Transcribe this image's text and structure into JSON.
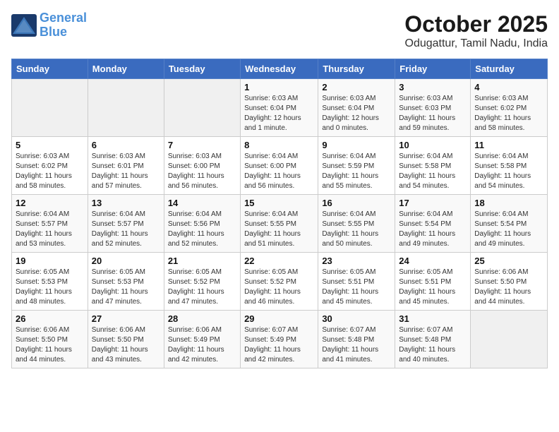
{
  "header": {
    "logo_line1": "General",
    "logo_line2": "Blue",
    "month": "October 2025",
    "location": "Odugattur, Tamil Nadu, India"
  },
  "weekdays": [
    "Sunday",
    "Monday",
    "Tuesday",
    "Wednesday",
    "Thursday",
    "Friday",
    "Saturday"
  ],
  "weeks": [
    [
      {
        "day": "",
        "info": ""
      },
      {
        "day": "",
        "info": ""
      },
      {
        "day": "",
        "info": ""
      },
      {
        "day": "1",
        "info": "Sunrise: 6:03 AM\nSunset: 6:04 PM\nDaylight: 12 hours\nand 1 minute."
      },
      {
        "day": "2",
        "info": "Sunrise: 6:03 AM\nSunset: 6:04 PM\nDaylight: 12 hours\nand 0 minutes."
      },
      {
        "day": "3",
        "info": "Sunrise: 6:03 AM\nSunset: 6:03 PM\nDaylight: 11 hours\nand 59 minutes."
      },
      {
        "day": "4",
        "info": "Sunrise: 6:03 AM\nSunset: 6:02 PM\nDaylight: 11 hours\nand 58 minutes."
      }
    ],
    [
      {
        "day": "5",
        "info": "Sunrise: 6:03 AM\nSunset: 6:02 PM\nDaylight: 11 hours\nand 58 minutes."
      },
      {
        "day": "6",
        "info": "Sunrise: 6:03 AM\nSunset: 6:01 PM\nDaylight: 11 hours\nand 57 minutes."
      },
      {
        "day": "7",
        "info": "Sunrise: 6:03 AM\nSunset: 6:00 PM\nDaylight: 11 hours\nand 56 minutes."
      },
      {
        "day": "8",
        "info": "Sunrise: 6:04 AM\nSunset: 6:00 PM\nDaylight: 11 hours\nand 56 minutes."
      },
      {
        "day": "9",
        "info": "Sunrise: 6:04 AM\nSunset: 5:59 PM\nDaylight: 11 hours\nand 55 minutes."
      },
      {
        "day": "10",
        "info": "Sunrise: 6:04 AM\nSunset: 5:58 PM\nDaylight: 11 hours\nand 54 minutes."
      },
      {
        "day": "11",
        "info": "Sunrise: 6:04 AM\nSunset: 5:58 PM\nDaylight: 11 hours\nand 54 minutes."
      }
    ],
    [
      {
        "day": "12",
        "info": "Sunrise: 6:04 AM\nSunset: 5:57 PM\nDaylight: 11 hours\nand 53 minutes."
      },
      {
        "day": "13",
        "info": "Sunrise: 6:04 AM\nSunset: 5:57 PM\nDaylight: 11 hours\nand 52 minutes."
      },
      {
        "day": "14",
        "info": "Sunrise: 6:04 AM\nSunset: 5:56 PM\nDaylight: 11 hours\nand 52 minutes."
      },
      {
        "day": "15",
        "info": "Sunrise: 6:04 AM\nSunset: 5:55 PM\nDaylight: 11 hours\nand 51 minutes."
      },
      {
        "day": "16",
        "info": "Sunrise: 6:04 AM\nSunset: 5:55 PM\nDaylight: 11 hours\nand 50 minutes."
      },
      {
        "day": "17",
        "info": "Sunrise: 6:04 AM\nSunset: 5:54 PM\nDaylight: 11 hours\nand 49 minutes."
      },
      {
        "day": "18",
        "info": "Sunrise: 6:04 AM\nSunset: 5:54 PM\nDaylight: 11 hours\nand 49 minutes."
      }
    ],
    [
      {
        "day": "19",
        "info": "Sunrise: 6:05 AM\nSunset: 5:53 PM\nDaylight: 11 hours\nand 48 minutes."
      },
      {
        "day": "20",
        "info": "Sunrise: 6:05 AM\nSunset: 5:53 PM\nDaylight: 11 hours\nand 47 minutes."
      },
      {
        "day": "21",
        "info": "Sunrise: 6:05 AM\nSunset: 5:52 PM\nDaylight: 11 hours\nand 47 minutes."
      },
      {
        "day": "22",
        "info": "Sunrise: 6:05 AM\nSunset: 5:52 PM\nDaylight: 11 hours\nand 46 minutes."
      },
      {
        "day": "23",
        "info": "Sunrise: 6:05 AM\nSunset: 5:51 PM\nDaylight: 11 hours\nand 45 minutes."
      },
      {
        "day": "24",
        "info": "Sunrise: 6:05 AM\nSunset: 5:51 PM\nDaylight: 11 hours\nand 45 minutes."
      },
      {
        "day": "25",
        "info": "Sunrise: 6:06 AM\nSunset: 5:50 PM\nDaylight: 11 hours\nand 44 minutes."
      }
    ],
    [
      {
        "day": "26",
        "info": "Sunrise: 6:06 AM\nSunset: 5:50 PM\nDaylight: 11 hours\nand 44 minutes."
      },
      {
        "day": "27",
        "info": "Sunrise: 6:06 AM\nSunset: 5:50 PM\nDaylight: 11 hours\nand 43 minutes."
      },
      {
        "day": "28",
        "info": "Sunrise: 6:06 AM\nSunset: 5:49 PM\nDaylight: 11 hours\nand 42 minutes."
      },
      {
        "day": "29",
        "info": "Sunrise: 6:07 AM\nSunset: 5:49 PM\nDaylight: 11 hours\nand 42 minutes."
      },
      {
        "day": "30",
        "info": "Sunrise: 6:07 AM\nSunset: 5:48 PM\nDaylight: 11 hours\nand 41 minutes."
      },
      {
        "day": "31",
        "info": "Sunrise: 6:07 AM\nSunset: 5:48 PM\nDaylight: 11 hours\nand 40 minutes."
      },
      {
        "day": "",
        "info": ""
      }
    ]
  ]
}
